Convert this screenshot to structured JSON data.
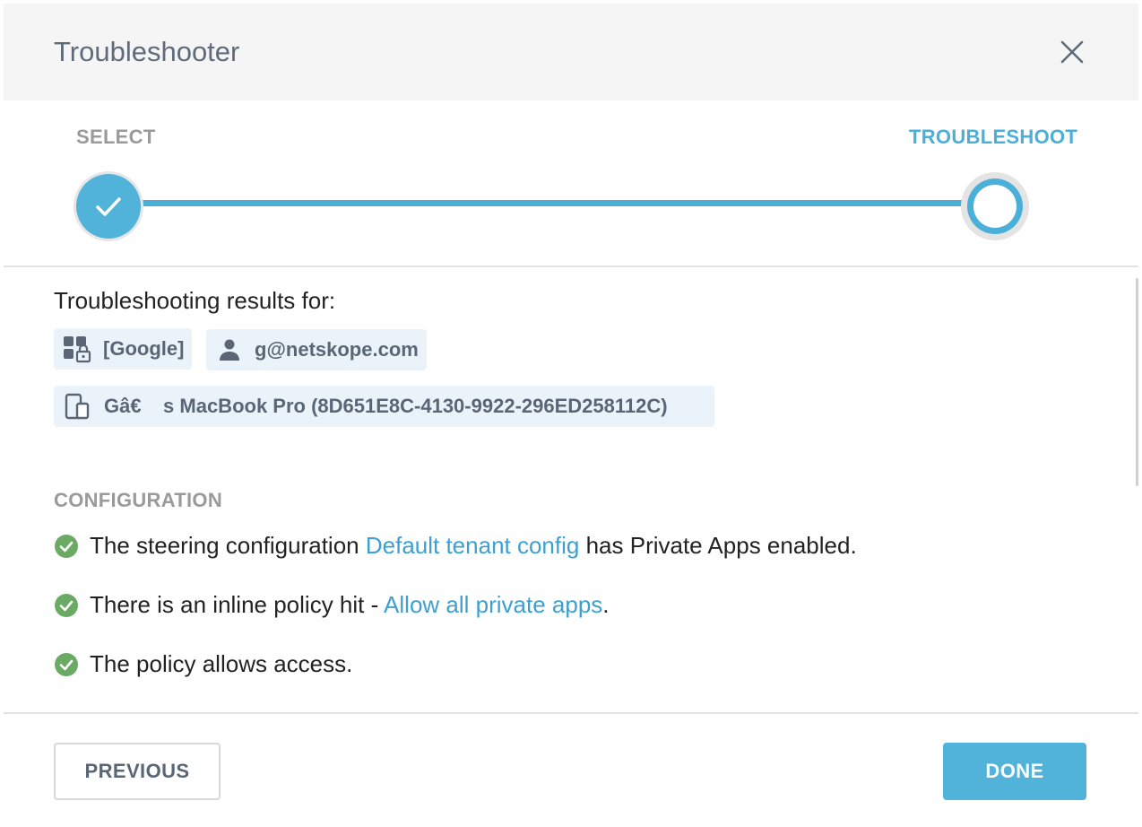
{
  "header": {
    "title": "Troubleshooter",
    "close_icon": "close-icon"
  },
  "stepper": {
    "steps": [
      {
        "label": "SELECT",
        "state": "completed"
      },
      {
        "label": "TROUBLESHOOT",
        "state": "current"
      }
    ],
    "accent_color": "#4ab0d9"
  },
  "results": {
    "title": "Troubleshooting results for:",
    "app_chip": {
      "icon": "app-lock-icon",
      "label": "[Google]"
    },
    "user_chip": {
      "icon": "user-icon",
      "label": "g@netskope.com"
    },
    "device_chip": {
      "icon": "device-icon",
      "label": "Gâ€    s MacBook Pro (8D651E8C-4130-9922-296ED258112C)"
    }
  },
  "configuration": {
    "label": "CONFIGURATION",
    "check_color": "#6aaa64",
    "items": [
      {
        "prefix": "The steering configuration ",
        "link": "Default tenant config",
        "suffix": " has Private Apps enabled."
      },
      {
        "prefix": "There is an inline policy hit - ",
        "link": "Allow all private apps",
        "suffix": "."
      },
      {
        "prefix": "The policy allows access.",
        "link": "",
        "suffix": ""
      }
    ]
  },
  "footer": {
    "previous_label": "PREVIOUS",
    "done_label": "DONE"
  }
}
